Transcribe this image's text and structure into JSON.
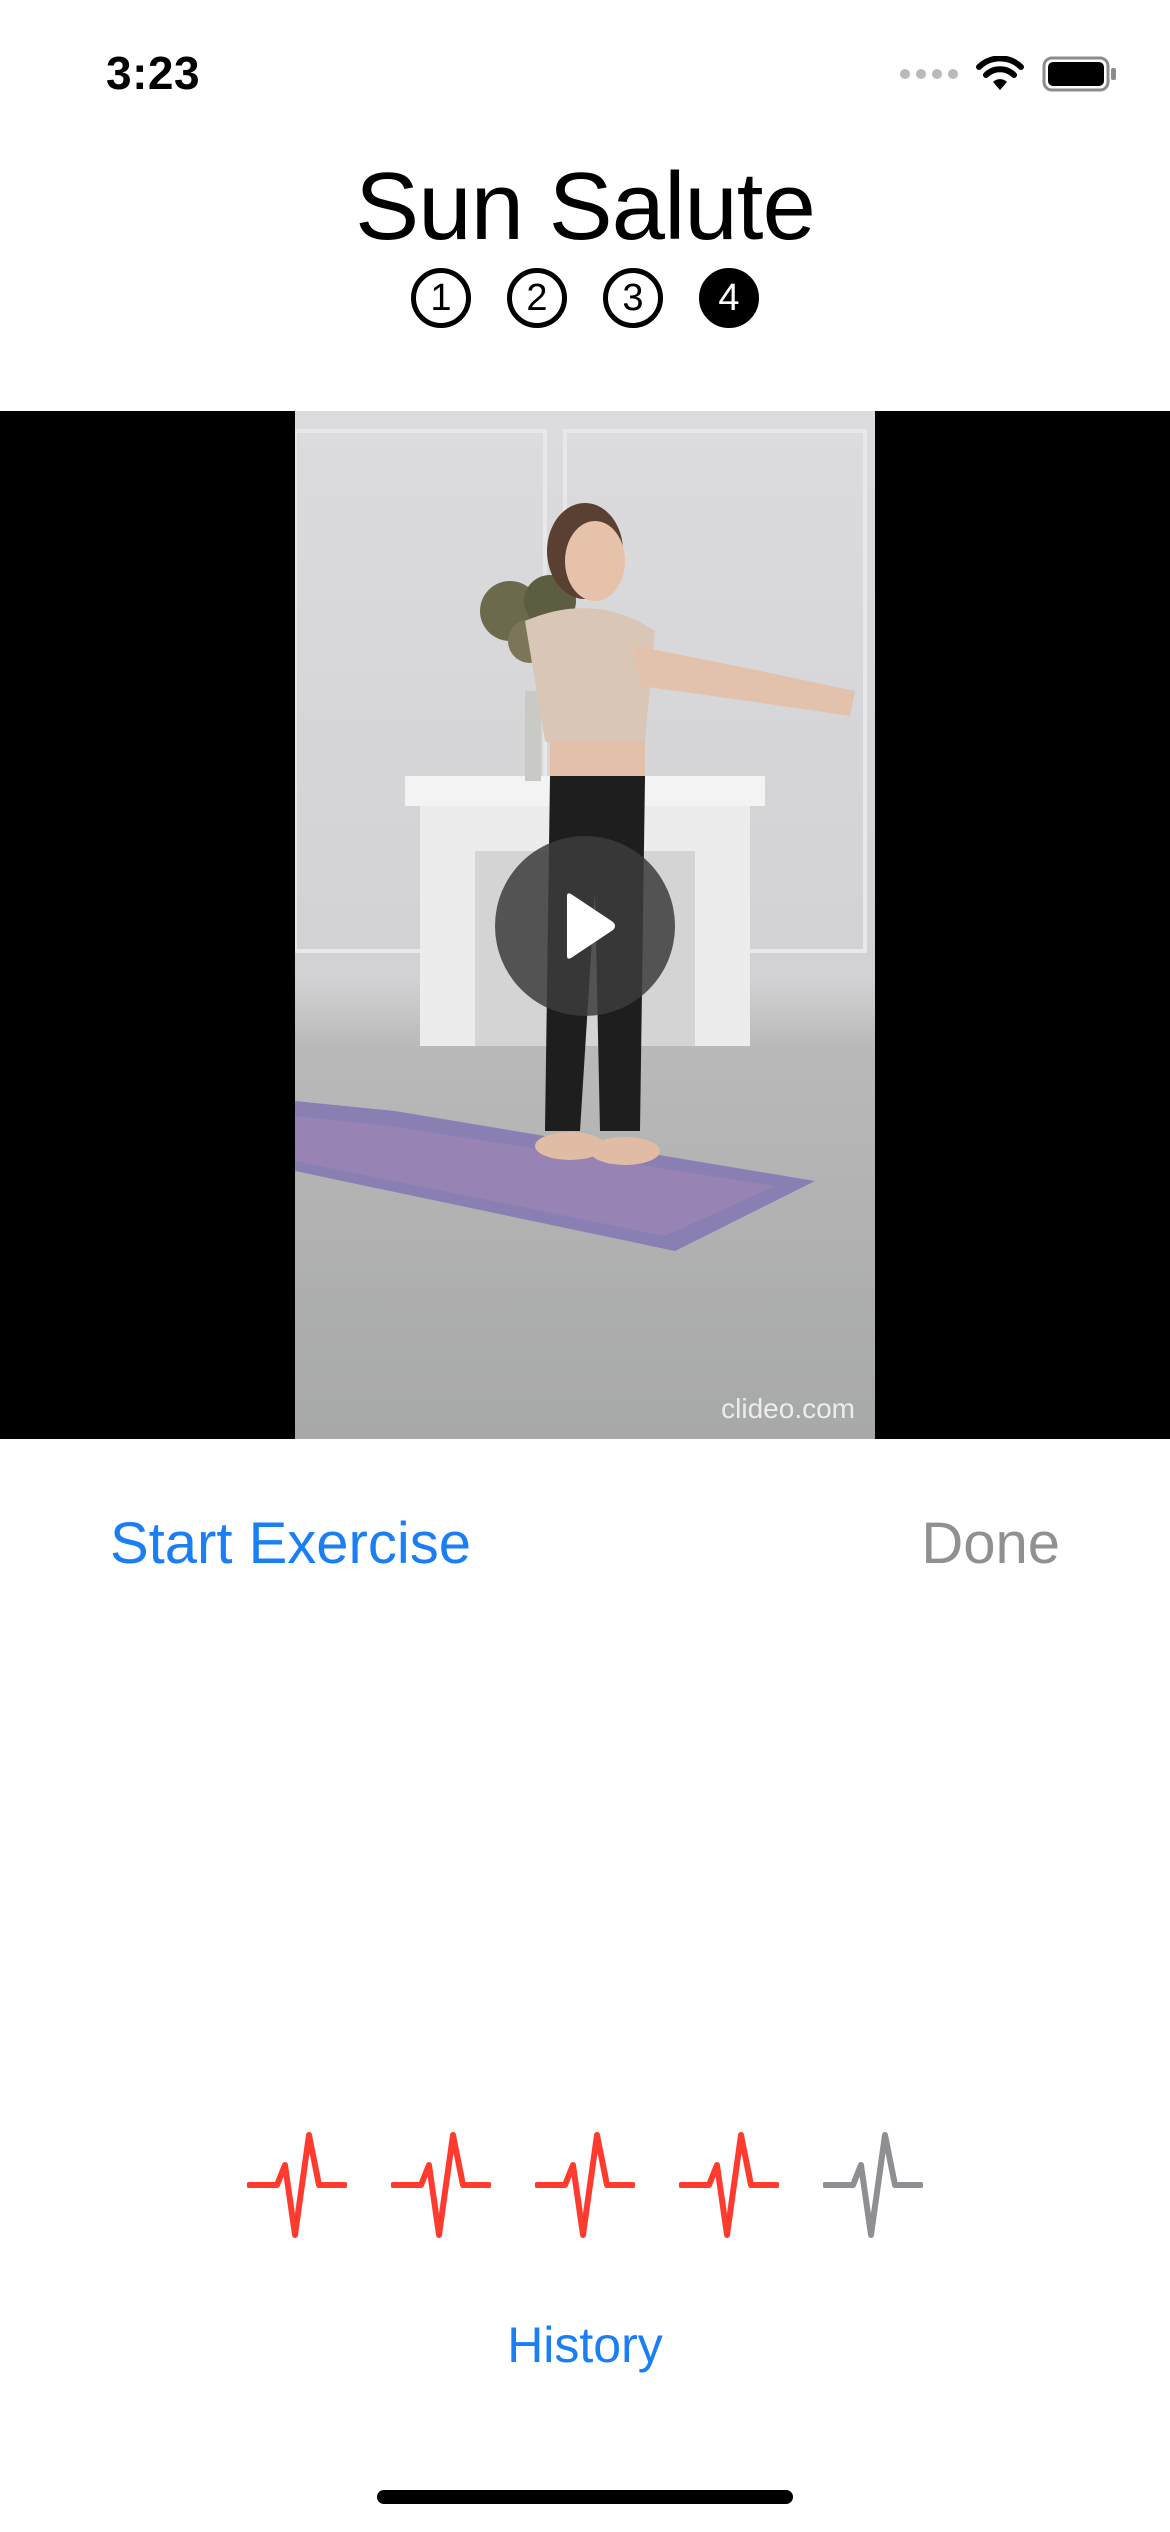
{
  "status_bar": {
    "time": "3:23"
  },
  "header": {
    "title": "Sun Salute",
    "steps": [
      {
        "label": "1",
        "active": false
      },
      {
        "label": "2",
        "active": false
      },
      {
        "label": "3",
        "active": false
      },
      {
        "label": "4",
        "active": true
      }
    ]
  },
  "video": {
    "watermark": "clideo.com",
    "state": "paused"
  },
  "actions": {
    "start_label": "Start Exercise",
    "done_label": "Done"
  },
  "rating": {
    "max": 5,
    "value": 4,
    "icon": "waveform-path-ecg-icon",
    "active_color": "#ff3b30",
    "inactive_color": "#8e8e93"
  },
  "footer": {
    "history_label": "History"
  }
}
